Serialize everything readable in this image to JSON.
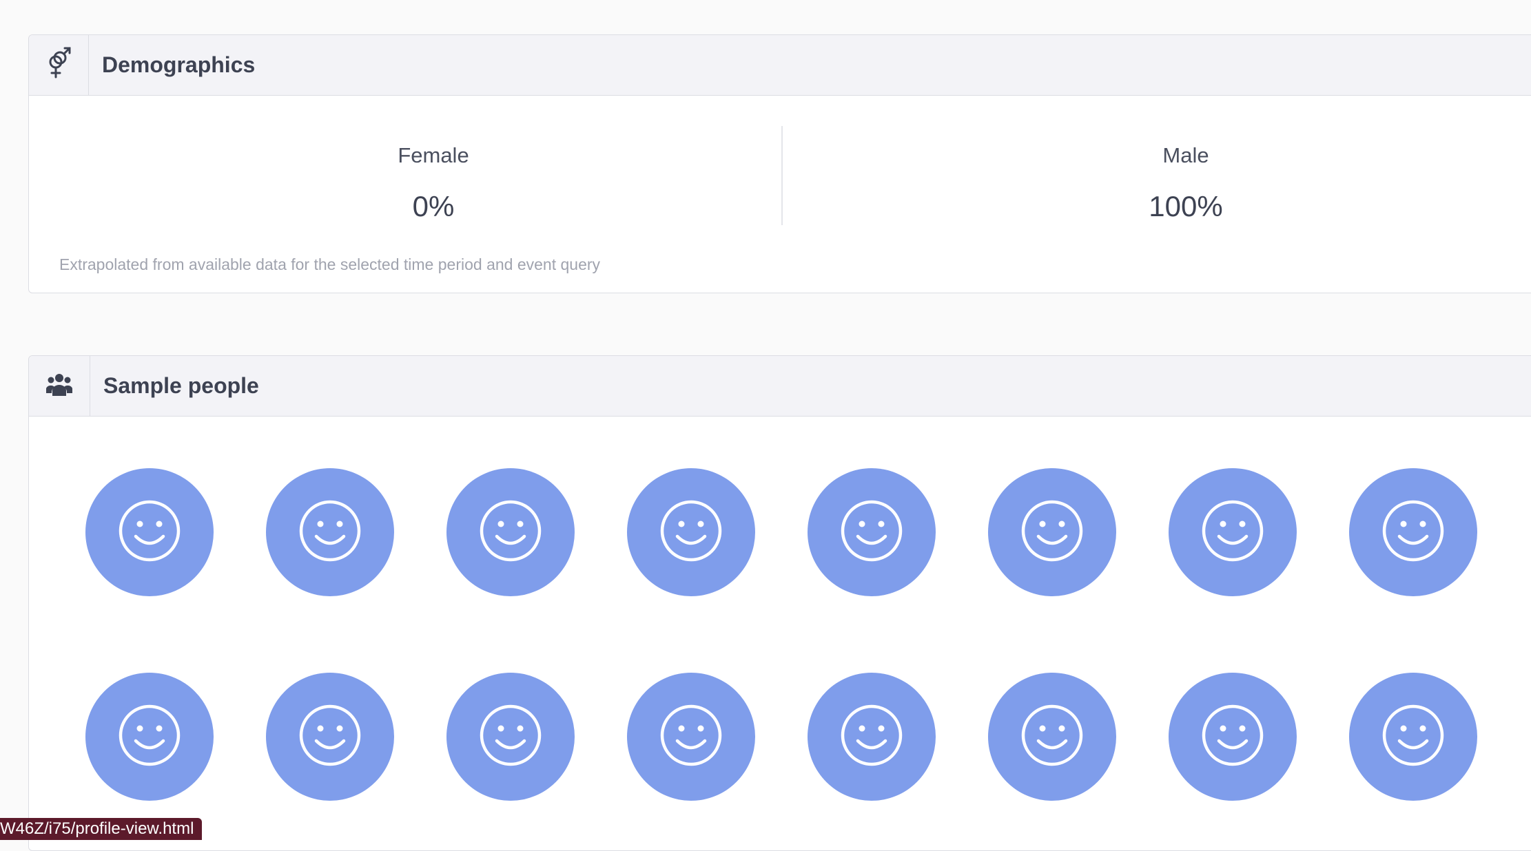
{
  "demographics": {
    "title": "Demographics",
    "icon": "gender-icon",
    "female_label": "Female",
    "female_value": "0%",
    "male_label": "Male",
    "male_value": "100%",
    "note": "Extrapolated from available data for the selected time period and event query"
  },
  "sample_people": {
    "title": "Sample people",
    "icon": "users-icon",
    "avatar_icon": "smiley-face-icon",
    "avatar_color": "#7f9deb",
    "rows": 2,
    "per_row": 8
  },
  "status_url": "W46Z/i75/profile-view.html"
}
